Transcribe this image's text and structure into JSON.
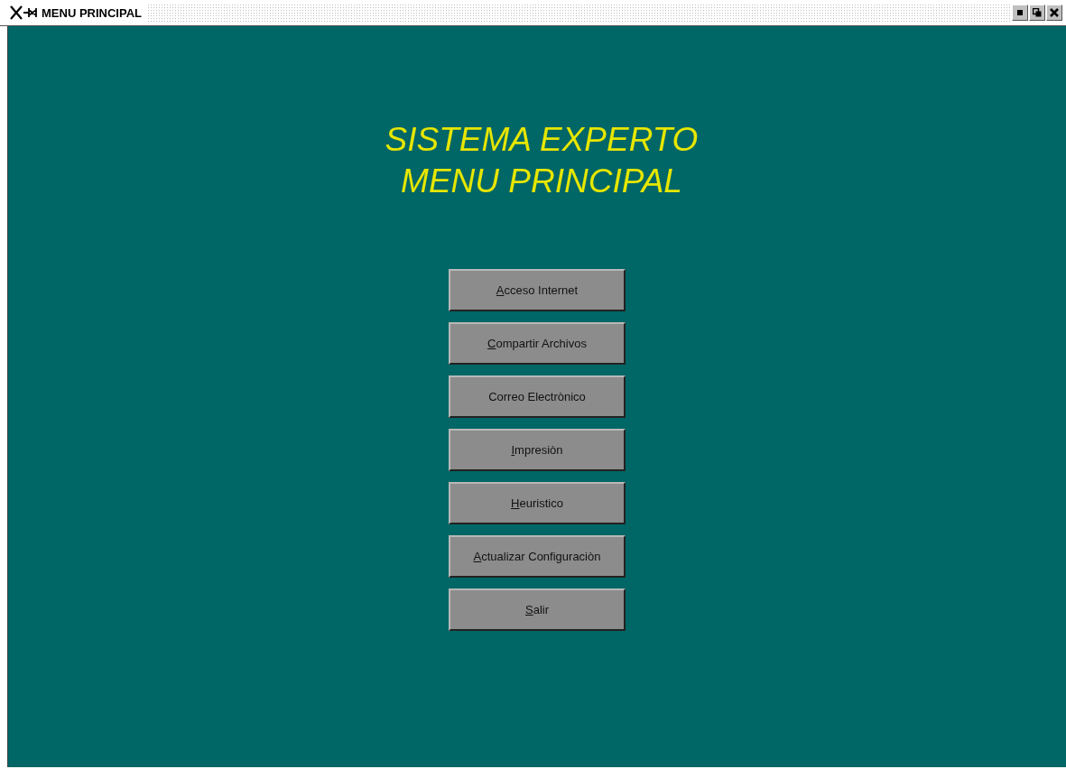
{
  "window": {
    "title": "MENU PRINCIPAL"
  },
  "heading": [
    "SISTEMA EXPERTO",
    "MENU PRINCIPAL"
  ],
  "buttons": [
    {
      "label": "Acceso Internet",
      "mnemonic_underlined": true
    },
    {
      "label": "Compartir Archivos",
      "mnemonic_underlined": true
    },
    {
      "label": "Correo Electrònico",
      "mnemonic_underlined": false
    },
    {
      "label": "Impresiòn",
      "mnemonic_underlined": true
    },
    {
      "label": "Heuristico",
      "mnemonic_underlined": true
    },
    {
      "label": "Actualizar Configuraciòn",
      "mnemonic_underlined": true
    },
    {
      "label": "Salir",
      "mnemonic_underlined": true
    }
  ]
}
